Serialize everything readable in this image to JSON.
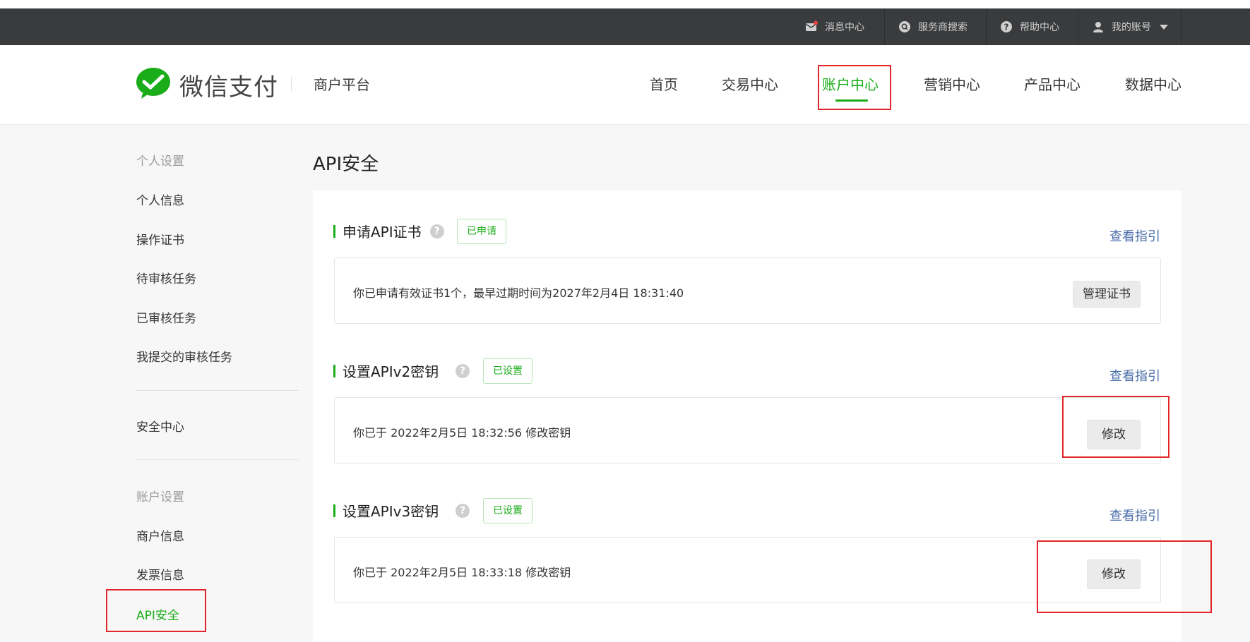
{
  "topbar": {
    "messages": "消息中心",
    "provider_search": "服务商搜索",
    "help": "帮助中心",
    "account": "我的账号"
  },
  "header": {
    "brand": "微信支付",
    "platform": "商户平台",
    "nav": [
      "首页",
      "交易中心",
      "账户中心",
      "营销中心",
      "产品中心",
      "数据中心"
    ],
    "active_nav": "账户中心"
  },
  "sidebar": {
    "group1_title": "个人设置",
    "group1_items": [
      "个人信息",
      "操作证书",
      "待审核任务",
      "已审核任务",
      "我提交的审核任务"
    ],
    "security_center": "安全中心",
    "group2_title": "账户设置",
    "group2_items": [
      "商户信息",
      "发票信息",
      "API安全"
    ],
    "active_item": "API安全"
  },
  "main": {
    "title": "API安全",
    "sections": [
      {
        "title": "申请API证书",
        "help": "?",
        "badge": "已申请",
        "guide": "查看指引",
        "info": "你已申请有效证书1个，最早过期时间为2027年2月4日 18:31:40",
        "button": "管理证书"
      },
      {
        "title": "设置APIv2密钥",
        "help": "?",
        "badge": "已设置",
        "guide": "查看指引",
        "info": "你已于 2022年2月5日 18:32:56 修改密钥",
        "button": "修改"
      },
      {
        "title": "设置APIv3密钥",
        "help": "?",
        "badge": "已设置",
        "guide": "查看指引",
        "info": "你已于 2022年2月5日 18:33:18 修改密钥",
        "button": "修改"
      }
    ]
  },
  "colors": {
    "brand_green": "#1aad19",
    "topbar": "#3a3b3d",
    "link": "#4a6ea8",
    "highlight_red": "#e3262a"
  },
  "icons": [
    "message-icon",
    "search-icon",
    "help-icon",
    "user-icon",
    "dropdown-caret-icon",
    "wechat-pay-logo-icon"
  ]
}
